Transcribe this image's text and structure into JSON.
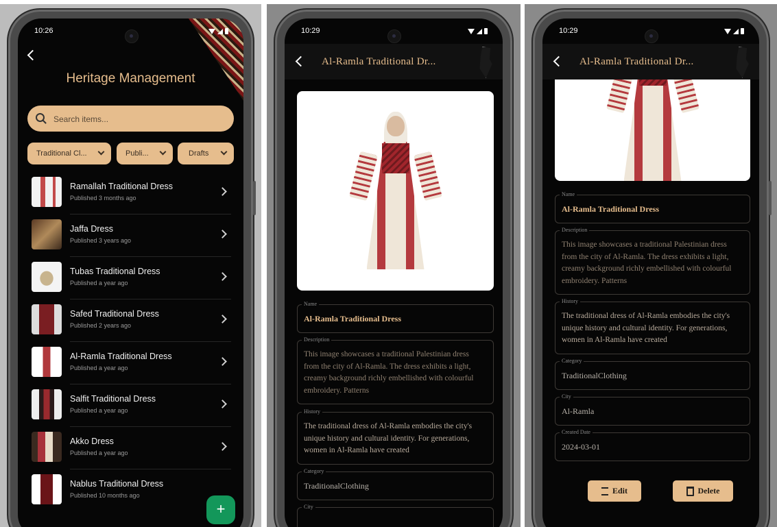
{
  "list_screen": {
    "status_time": "10:26",
    "title": "Heritage Management",
    "search": {
      "placeholder": "Search items..."
    },
    "filters": [
      {
        "label": "Traditional Cl..."
      },
      {
        "label": "Publi..."
      },
      {
        "label": "Drafts"
      }
    ],
    "items": [
      {
        "name": "Ramallah Traditional Dress",
        "subtitle": "Published 3 months ago"
      },
      {
        "name": "Jaffa Dress",
        "subtitle": "Published 3 years ago"
      },
      {
        "name": "Tubas Traditional Dress",
        "subtitle": "Published a year ago"
      },
      {
        "name": "Safed Traditional Dress",
        "subtitle": "Published 2 years ago"
      },
      {
        "name": "Al-Ramla Traditional Dress",
        "subtitle": "Published a year ago"
      },
      {
        "name": "Salfit Traditional Dress",
        "subtitle": "Published a year ago"
      },
      {
        "name": "Akko Dress",
        "subtitle": "Published a year ago"
      },
      {
        "name": "Nablus Traditional Dress",
        "subtitle": "Published 10 months ago"
      }
    ],
    "fab_label": "+"
  },
  "detail_screen": {
    "status_time": "10:29",
    "title": "Al-Ramla Traditional Dr...",
    "labels": {
      "name": "Name",
      "description": "Description",
      "history": "History",
      "category": "Category",
      "city": "City",
      "created_date": "Created Date"
    },
    "name": "Al-Ramla Traditional Dress",
    "description": "This image showcases a traditional Palestinian dress from the city of Al-Ramla. The dress exhibits a light, creamy background richly embellished with colourful embroidery. Patterns",
    "history": "The traditional dress of Al-Ramla embodies the city's unique history and cultural identity. For generations, women in Al-Ramla have created",
    "category": "TraditionalClothing",
    "city": "Al-Ramla",
    "created_date": "2024-03-01",
    "edit_label": "Edit",
    "delete_label": "Delete"
  },
  "colors": {
    "accent": "#e6bd8d",
    "background": "#060606",
    "fab": "#13975a"
  }
}
